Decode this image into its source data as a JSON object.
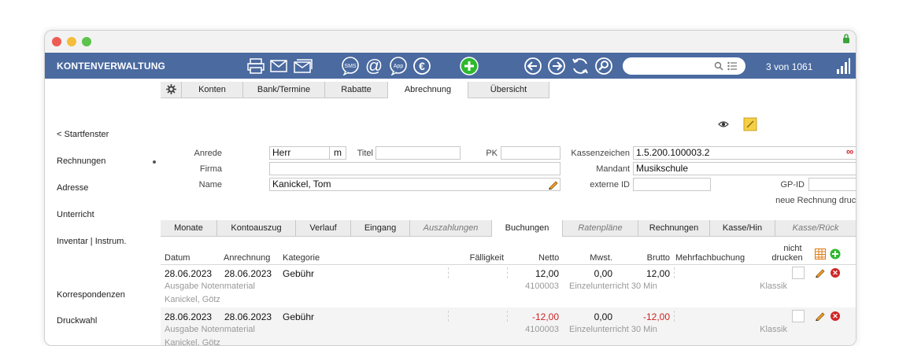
{
  "app": {
    "title": "KONTENVERWALTUNG",
    "record_counter": "3 von 1061"
  },
  "sidebar": {
    "items": [
      {
        "label": "< Startfenster"
      },
      {
        "label": "Rechnungen"
      },
      {
        "label": "Adresse"
      },
      {
        "label": "Unterricht"
      },
      {
        "label": "Inventar | Instrum."
      },
      {
        "label": "Korrespondenzen"
      },
      {
        "label": "Druckwahl"
      }
    ]
  },
  "top_tabs": [
    {
      "label": "Konten"
    },
    {
      "label": "Bank/Termine"
    },
    {
      "label": "Rabatte"
    },
    {
      "label": "Abrechnung",
      "active": true
    },
    {
      "label": "Übersicht"
    }
  ],
  "form": {
    "anrede_label": "Anrede",
    "anrede_value": "Herr",
    "anrede_suffix": "m",
    "titel_label": "Titel",
    "titel_value": "",
    "pk_label": "PK",
    "pk_value": "",
    "firma_label": "Firma",
    "firma_value": "",
    "name_label": "Name",
    "name_value": "Kanickel, Tom",
    "kassenzeichen_label": "Kassenzeichen",
    "kassenzeichen_value": "1.5.200.100003.2",
    "mandant_label": "Mandant",
    "mandant_value": "Musikschule",
    "externe_id_label": "externe ID",
    "externe_id_value": "",
    "gpid_label": "GP-ID",
    "gpid_value": "",
    "neue_rechnung_label": "neue Rechnung drucken"
  },
  "sub_tabs": [
    {
      "label": "Monate"
    },
    {
      "label": "Kontoauszug"
    },
    {
      "label": "Verlauf"
    },
    {
      "label": "Eingang"
    },
    {
      "label": "Auszahlungen",
      "italic": true
    },
    {
      "label": "Buchungen",
      "active": true
    },
    {
      "label": "Ratenpläne",
      "italic": true
    },
    {
      "label": "Rechnungen"
    },
    {
      "label": "Kasse/Hin"
    },
    {
      "label": "Kasse/Rück",
      "italic": true
    }
  ],
  "table": {
    "headers": {
      "datum": "Datum",
      "anrechnung": "Anrechnung",
      "kategorie": "Kategorie",
      "faelligkeit": "Fälligkeit",
      "netto": "Netto",
      "mwst": "Mwst.",
      "brutto": "Brutto",
      "mehrfach": "Mehrfachbuchung",
      "nicht": "nicht",
      "drucken": "drucken"
    },
    "rows": [
      {
        "datum": "28.06.2023",
        "anrechnung": "28.06.2023",
        "kategorie": "Gebühr",
        "netto": "12,00",
        "mwst": "0,00",
        "brutto": "12,00",
        "beschreibung": "Ausgabe Notenmaterial",
        "konto": "4100003",
        "unterricht": "Einzelunterricht 30 Min",
        "fach": "Klassik",
        "person": "Kanickel, Götz"
      },
      {
        "datum": "28.06.2023",
        "anrechnung": "28.06.2023",
        "kategorie": "Gebühr",
        "netto": "-12,00",
        "mwst": "0,00",
        "brutto": "-12,00",
        "beschreibung": "Ausgabe Notenmaterial",
        "konto": "4100003",
        "unterricht": "Einzelunterricht 30 Min",
        "fach": "Klassik",
        "person": "Kanickel, Götz"
      }
    ]
  },
  "colors": {
    "toolbar": "#4a6aa0",
    "accent_green": "#2eb82e",
    "negative": "#cc2222",
    "delete": "#d02626"
  }
}
